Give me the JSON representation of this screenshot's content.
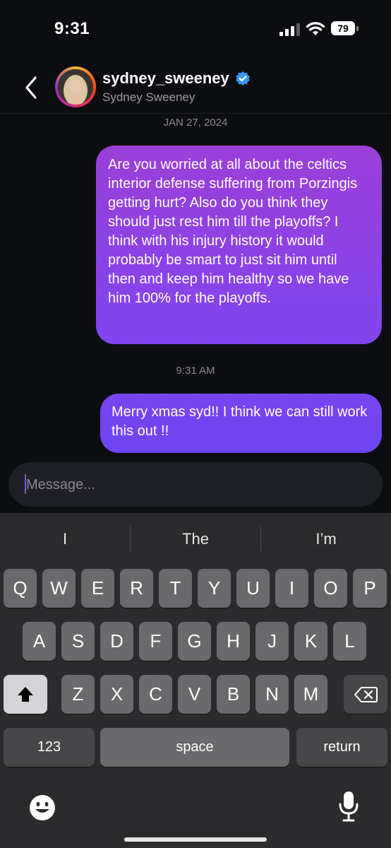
{
  "status_bar": {
    "time": "9:31",
    "battery": "79"
  },
  "header": {
    "username": "sydney_sweeney",
    "full_name": "Sydney Sweeney",
    "verified": true
  },
  "conversation": {
    "date_separator": "JAN 27, 2024",
    "time_separator": "9:31 AM",
    "messages": [
      {
        "sender": "me",
        "text": "Are you worried at all about the celtics interior defense suffering from Porzingis getting hurt? Also do you think they should just rest him till the playoffs? I think with his injury history it would probably be smart to just sit him until then and keep him healthy so we have him 100% for the playoffs."
      },
      {
        "sender": "me",
        "text": "Merry xmas syd!! I think we can still work this out !!"
      }
    ]
  },
  "composer": {
    "placeholder": "Message..."
  },
  "keyboard": {
    "suggestions": [
      "I",
      "The",
      "I’m"
    ],
    "row1": [
      "Q",
      "W",
      "E",
      "R",
      "T",
      "Y",
      "U",
      "I",
      "O",
      "P"
    ],
    "row2": [
      "A",
      "S",
      "D",
      "F",
      "G",
      "H",
      "J",
      "K",
      "L"
    ],
    "row3": [
      "Z",
      "X",
      "C",
      "V",
      "B",
      "N",
      "M"
    ],
    "numbers_label": "123",
    "space_label": "space",
    "return_label": "return"
  },
  "colors": {
    "bubble_start": "#9b3fd8",
    "bubble_end": "#6d45f2",
    "background": "#0c0d10",
    "keyboard": "#2b2b2d"
  }
}
